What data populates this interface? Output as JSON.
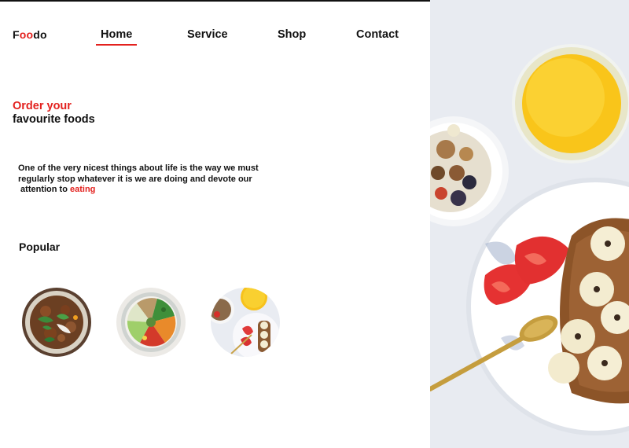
{
  "brand": {
    "logo_parts": [
      "F",
      "oo",
      "do"
    ],
    "accent_color": "#e3211e"
  },
  "nav": {
    "items": [
      {
        "label": "Home",
        "active": true
      },
      {
        "label": "Service"
      },
      {
        "label": "Shop"
      },
      {
        "label": "Contact"
      }
    ]
  },
  "hero": {
    "heading_red": "Order your",
    "heading_black": "favourite foods",
    "description_line1": "One of the very nicest things about life is  the way we must",
    "description_line2": "regularly stop whatever it is we are doing and devote our",
    "description_line3_prefix": " attention to ",
    "description_highlight": "eating"
  },
  "popular": {
    "title": "Popular",
    "items": [
      {
        "icon": "meat-salad-bowl-image"
      },
      {
        "icon": "veggie-bowl-image"
      },
      {
        "icon": "breakfast-plate-image"
      }
    ]
  },
  "hero_image": {
    "icon": "breakfast-toast-fruit-juice-photo"
  }
}
